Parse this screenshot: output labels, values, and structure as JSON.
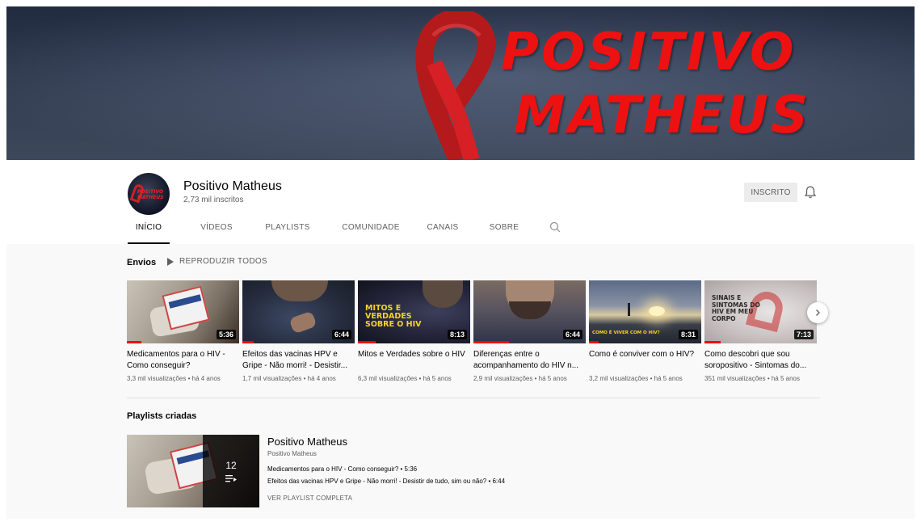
{
  "banner": {
    "line1": "POSITIVO",
    "line2": "MATHEUS"
  },
  "channel": {
    "name": "Positivo Matheus",
    "subscribers": "2,73 mil inscritos",
    "subscribe_label": "INSCRITO",
    "avatar_text": "POSITIVO MATHEUS"
  },
  "tabs": [
    "INÍCIO",
    "VÍDEOS",
    "PLAYLISTS",
    "COMUNIDADE",
    "CANAIS",
    "SOBRE"
  ],
  "uploads": {
    "title": "Envios",
    "play_all": "REPRODUZIR TODOS",
    "videos": [
      {
        "title": "Medicamentos para o HIV - Como conseguir?",
        "duration": "5:36",
        "views": "3,3 mil visualizações",
        "age": "há 4 anos"
      },
      {
        "title": "Efeitos das vacinas HPV e Gripe - Não morri! - Desistir...",
        "duration": "6:44",
        "views": "1,7 mil visualizações",
        "age": "há 4 anos"
      },
      {
        "title": "Mitos e Verdades sobre o HIV",
        "duration": "8:13",
        "views": "6,3 mil visualizações",
        "age": "há 5 anos",
        "overlay": "MITOS E VERDADES SOBRE O HIV"
      },
      {
        "title": "Diferenças entre o acompanhamento do HIV n...",
        "duration": "6:44",
        "views": "2,9 mil visualizações",
        "age": "há 5 anos"
      },
      {
        "title": "Como é conviver com o HIV?",
        "duration": "8:31",
        "views": "3,2 mil visualizações",
        "age": "há 5 anos",
        "overlay": "COMO É VIVER COM O HIV?"
      },
      {
        "title": "Como descobri que sou soropositivo - Sintomas do...",
        "duration": "7:13",
        "views": "351 mil visualizações",
        "age": "há 5 anos",
        "overlay": "SINAIS E SINTOMAS DO HIV EM MEU CORPO"
      }
    ]
  },
  "playlists": {
    "title": "Playlists criadas",
    "item": {
      "title": "Positivo Matheus",
      "author": "Positivo Matheus",
      "count": "12",
      "videos": [
        {
          "title": "Medicamentos para o HIV - Como conseguir?",
          "duration": "5:36"
        },
        {
          "title": "Efeitos das vacinas HPV e Gripe - Não morri! - Desistir de tudo, sim ou não?",
          "duration": "6:44"
        }
      ],
      "view_full": "VER PLAYLIST COMPLETA"
    }
  },
  "colors": {
    "accent_red": "#ff0000",
    "banner_text": "#ee1111",
    "page_bg": "#f9f9f9"
  },
  "icons": [
    "play-icon",
    "search-icon",
    "bell-icon",
    "chevron-right-icon",
    "playlist-icon"
  ]
}
